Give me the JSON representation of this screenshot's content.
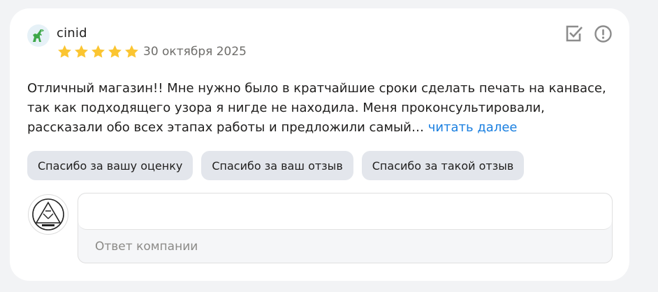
{
  "review": {
    "username": "cinid",
    "rating": 5,
    "date": "30 октября 2025",
    "text": "Отличный магазин!! Мне нужно было в кратчайшие сроки сделать печать на канвасе, так как подходящего узора я нигде не находила. Меня проконсультировали, рассказали обо всех этапах работы и предложили самый…",
    "read_more": "читать далее"
  },
  "quick_replies": [
    "Спасибо за вашу оценку",
    "Спасибо за ваш отзыв",
    "Спасибо за такой отзыв"
  ],
  "reply": {
    "value": "",
    "label": "Ответ компании"
  },
  "icons": {
    "user_avatar": "dinosaur-icon",
    "star": "star-icon",
    "mark": "checkbox-check-icon",
    "report": "exclamation-circle-icon",
    "company_logo": "company-logo"
  },
  "colors": {
    "star": "#fbc531",
    "link": "#1a7fe0",
    "chip_bg": "#e3e6ec",
    "dino": "#3ea849"
  }
}
